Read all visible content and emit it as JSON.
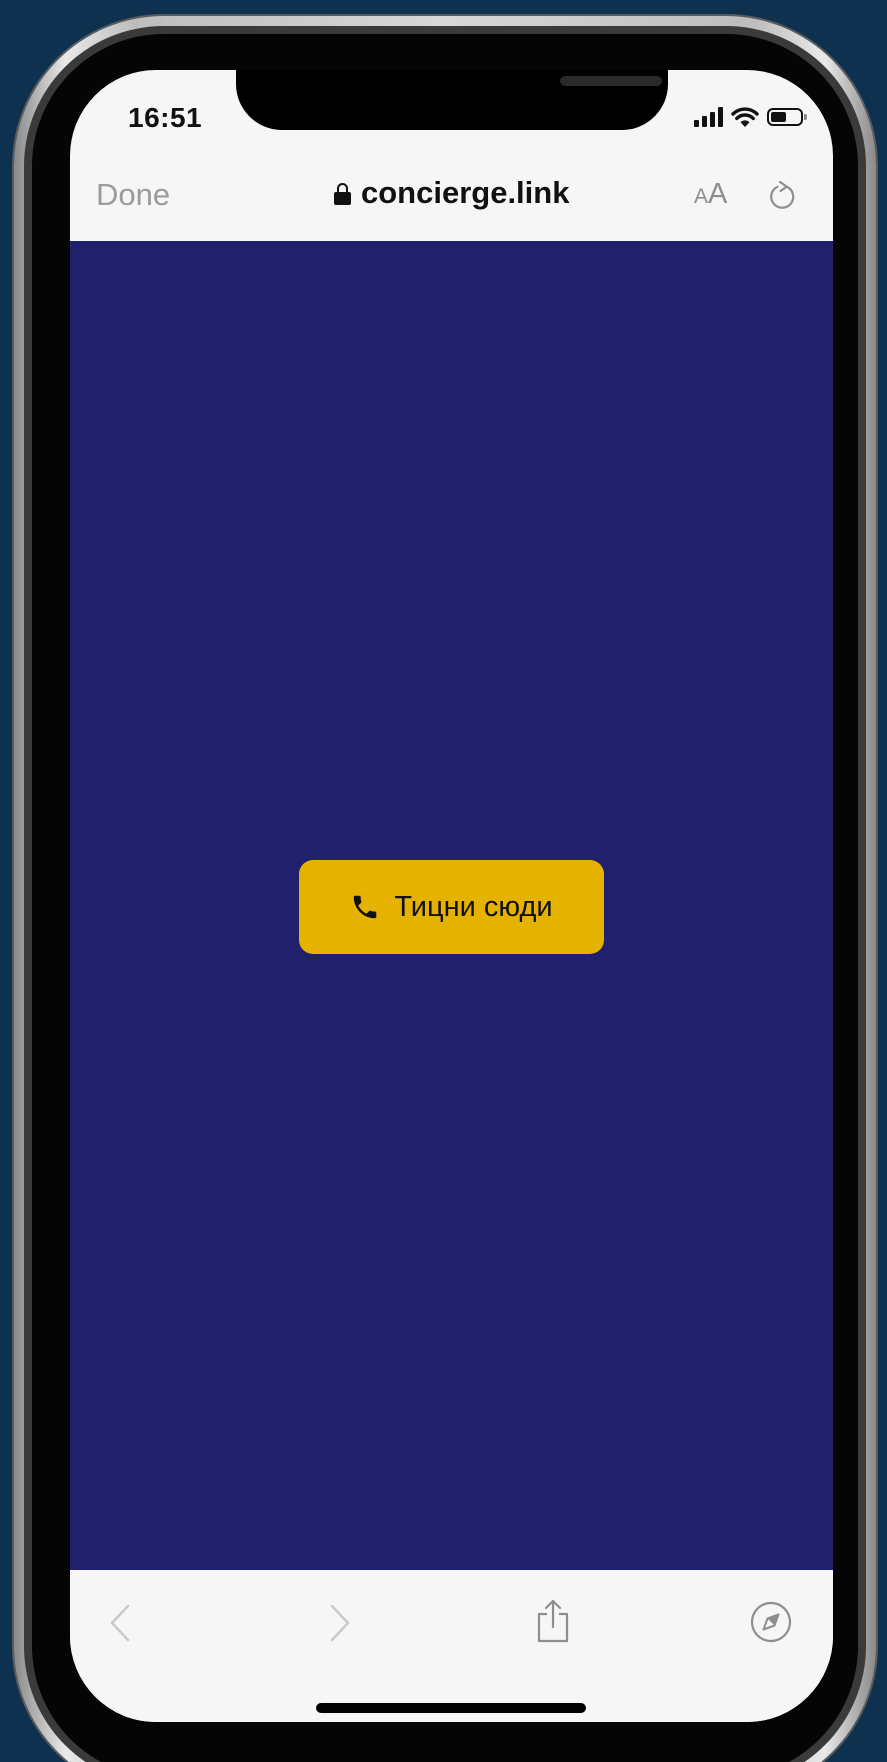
{
  "status_bar": {
    "time": "16:51",
    "icons": [
      "signal-icon",
      "wifi-icon",
      "battery-icon"
    ]
  },
  "browser_toolbar": {
    "done_label": "Done",
    "url": "concierge.link",
    "text_size_small": "A",
    "text_size_large": "A",
    "icons": [
      "lock-icon",
      "reload-icon"
    ]
  },
  "page": {
    "background_color": "#20206c",
    "call_button": {
      "label": "Тицни сюди",
      "icon": "phone-icon",
      "color": "#e6b200"
    }
  },
  "bottom_bar": {
    "icons": [
      "back-icon",
      "forward-icon",
      "share-icon",
      "compass-icon"
    ]
  }
}
